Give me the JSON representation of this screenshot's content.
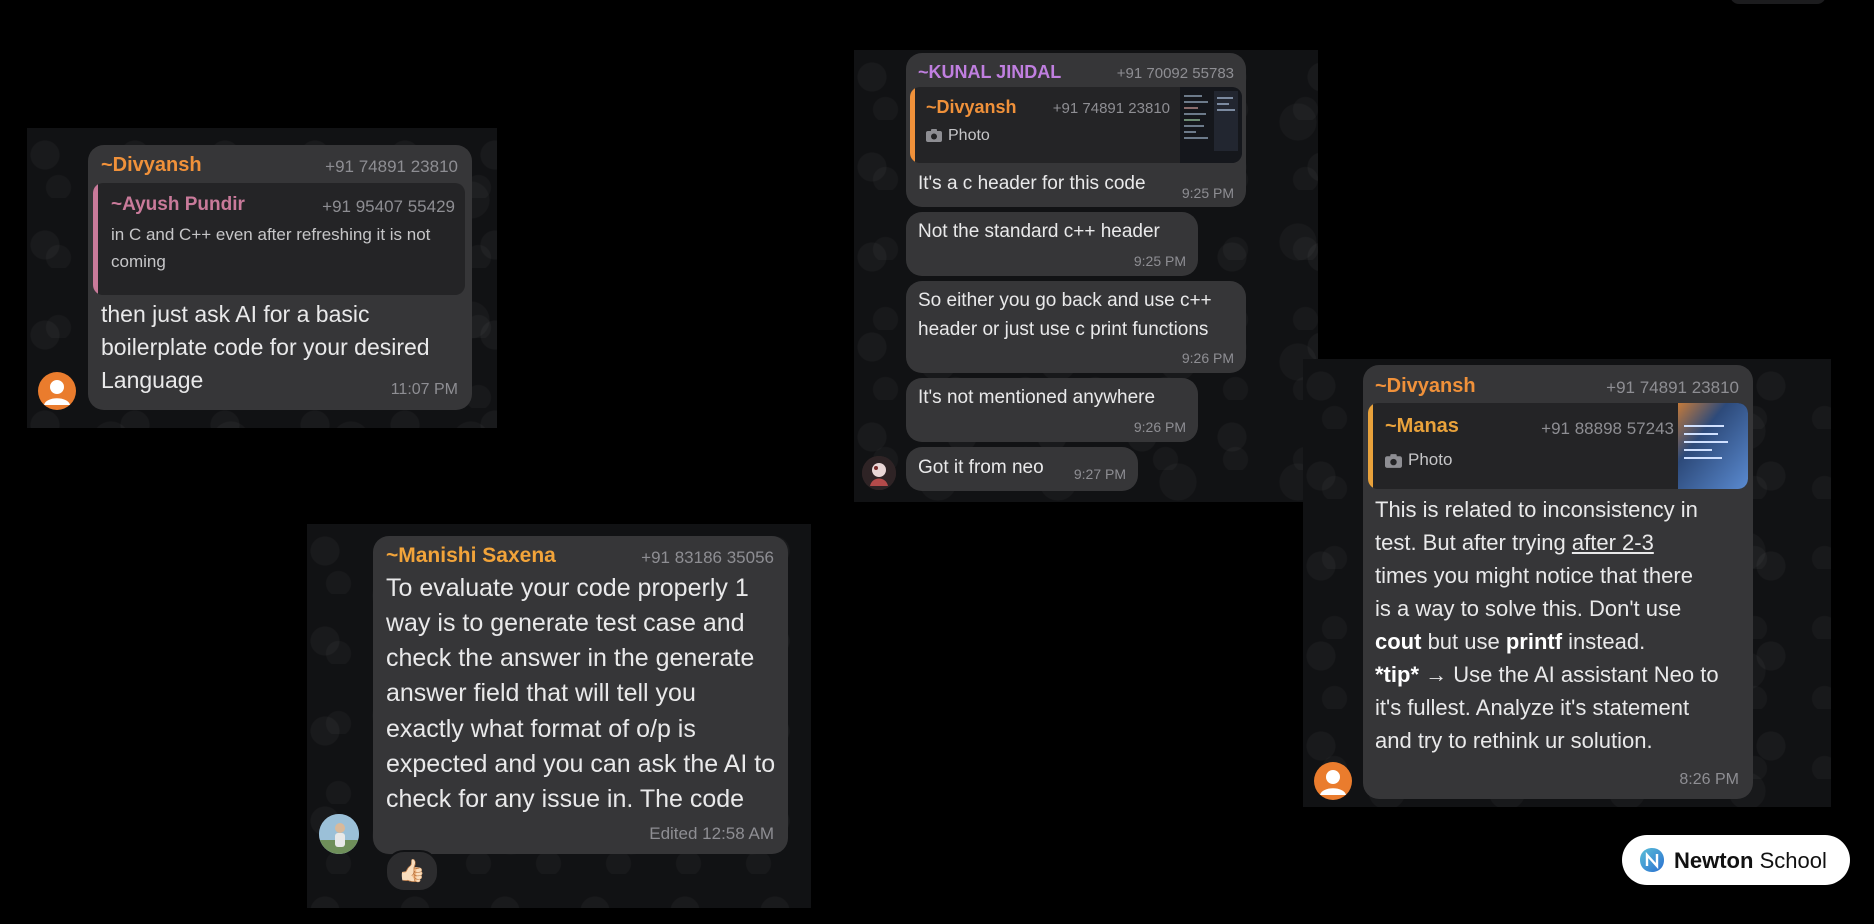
{
  "colors": {
    "orange": "#f0913a",
    "pink": "#c97a9a",
    "purple": "#c07fe0",
    "gold": "#f2a43a",
    "manas": "#e9a23b",
    "bubble": "#363638",
    "quote_bg": "#242426",
    "meta": "#8e8e93"
  },
  "card1": {
    "sender": "~Divyansh",
    "phone": "+91 74891 23810",
    "quote": {
      "sender": "~Ayush Pundir",
      "phone": "+91 95407 55429",
      "line1": "in C and C++ even after refreshing it is not",
      "line2": "coming"
    },
    "line1": "then just ask AI for a basic",
    "line2": "boilerplate code for your desired",
    "line3": "Language",
    "time": "11:07 PM"
  },
  "card2": {
    "sender": "~Manishi Saxena",
    "phone": "+91 83186 35056",
    "lines": [
      "To evaluate your code properly 1",
      "way is to generate test case and",
      "check the answer in the generate",
      "answer field that will tell you",
      "exactly what format of o/p is",
      "expected and you can ask the AI to",
      "check for any issue in. The code"
    ],
    "edited": "Edited",
    "time": "12:58 AM",
    "reaction": "👍🏻"
  },
  "card3": {
    "sender": "~KUNAL JINDAL",
    "phone": "+91 70092 55783",
    "quote": {
      "sender": "~Divyansh",
      "phone": "+91 74891 23810",
      "media": "Photo"
    },
    "messages": [
      {
        "text": "It's a c header for this code",
        "time": "9:25 PM"
      },
      {
        "text": "Not the standard c++ header",
        "time": "9:25 PM"
      },
      {
        "line1": "So either you go back and use c++",
        "line2": "header or just use c print functions",
        "time": "9:26 PM"
      },
      {
        "text": "It's not mentioned anywhere",
        "time": "9:26 PM"
      },
      {
        "text": "Got it from neo",
        "time": "9:27 PM"
      }
    ]
  },
  "card4": {
    "sender": "~Divyansh",
    "phone": "+91 74891 23810",
    "quote": {
      "sender": "~Manas",
      "phone": "+91 88898 57243",
      "media": "Photo"
    },
    "l1": "This is related to inconsistency in",
    "l2a": "test. But after trying ",
    "l2b": "after 2-3",
    "l3": "times you might notice that there",
    "l4": "is a way to solve this. Don't use",
    "l5a": "cout",
    "l5b": " but use ",
    "l5c": "printf",
    "l5d": " instead.",
    "l6a": "*tip*",
    "l6b": " → Use the AI assistant Neo to",
    "l7": "it's fullest. Analyze it's statement",
    "l8": "and try to rethink ur solution.",
    "time": "8:26 PM"
  },
  "brand": {
    "name_bold": "Newton",
    "name_rest": " School"
  }
}
